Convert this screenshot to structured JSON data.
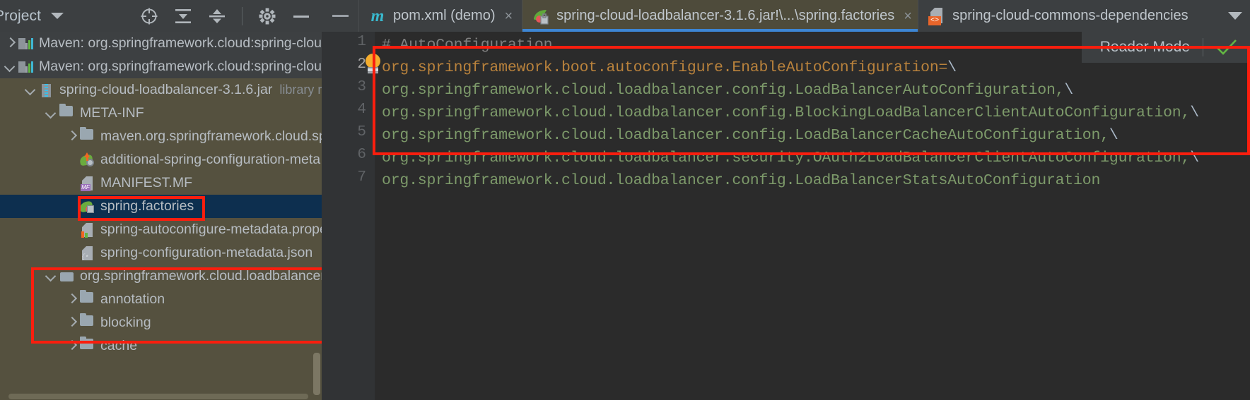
{
  "left_panel": {
    "title": "Project",
    "toolbar_icons": [
      {
        "name": "locate-target-icon"
      },
      {
        "name": "expand-all-icon"
      },
      {
        "name": "collapse-all-icon"
      },
      {
        "name": "settings-gear-icon"
      },
      {
        "name": "hide-panel-icon"
      }
    ],
    "tree": [
      {
        "label": "Maven: org.springframework.cloud:spring-cloud-",
        "arrow": "right",
        "icon": "maven-icon",
        "indent": 0,
        "bg": "dark",
        "suffix": ""
      },
      {
        "label": "Maven: org.springframework.cloud:spring-cloud-",
        "arrow": "down",
        "icon": "maven-icon",
        "indent": 0,
        "bg": "dark",
        "suffix": ""
      },
      {
        "label": "spring-cloud-loadbalancer-3.1.6.jar",
        "arrow": "down",
        "icon": "jar-icon",
        "indent": 1,
        "bg": "",
        "suffix": "library ro"
      },
      {
        "label": "META-INF",
        "arrow": "down",
        "icon": "folder-icon",
        "indent": 2,
        "bg": "",
        "suffix": ""
      },
      {
        "label": "maven.org.springframework.cloud.spr",
        "arrow": "right",
        "icon": "folder-icon",
        "indent": 3,
        "bg": "",
        "suffix": ""
      },
      {
        "label": "additional-spring-configuration-meta",
        "arrow": "none",
        "icon": "spring-config-metadata-icon",
        "indent": 3,
        "bg": "",
        "suffix": ""
      },
      {
        "label": "MANIFEST.MF",
        "arrow": "none",
        "icon": "manifest-icon",
        "indent": 3,
        "bg": "",
        "suffix": ""
      },
      {
        "label": "spring.factories",
        "arrow": "none",
        "icon": "spring-factories-icon",
        "indent": 3,
        "bg": "selected",
        "suffix": ""
      },
      {
        "label": "spring-autoconfigure-metadata.prope",
        "arrow": "none",
        "icon": "properties-icon",
        "indent": 3,
        "bg": "",
        "suffix": ""
      },
      {
        "label": "spring-configuration-metadata.json",
        "arrow": "none",
        "icon": "json-icon",
        "indent": 3,
        "bg": "",
        "suffix": ""
      },
      {
        "label": "org.springframework.cloud.loadbalancer",
        "arrow": "down",
        "icon": "package-icon",
        "indent": 2,
        "bg": "",
        "suffix": ""
      },
      {
        "label": "annotation",
        "arrow": "right",
        "icon": "folder-icon",
        "indent": 3,
        "bg": "",
        "suffix": ""
      },
      {
        "label": "blocking",
        "arrow": "right",
        "icon": "folder-icon",
        "indent": 3,
        "bg": "",
        "suffix": ""
      },
      {
        "label": "cache",
        "arrow": "right",
        "icon": "folder-icon",
        "indent": 3,
        "bg": "",
        "suffix": ""
      }
    ]
  },
  "tabs": [
    {
      "label": "pom.xml (demo)",
      "icon": "maven-m-icon",
      "active": false,
      "close": "×"
    },
    {
      "label": "spring-cloud-loadbalancer-3.1.6.jar!\\...\\spring.factories",
      "icon": "spring-factories-icon",
      "active": true,
      "close": "×"
    },
    {
      "label": "spring-cloud-commons-dependencies",
      "icon": "xml-file-icon",
      "active": false,
      "close": ""
    }
  ],
  "editor": {
    "line_numbers": [
      "1",
      "2",
      "3",
      "4",
      "5",
      "6",
      "7"
    ],
    "current_line": "2",
    "lines": [
      {
        "n": 1,
        "segments": [
          {
            "text": "# AutoConfiguration",
            "cls": "c-comment"
          }
        ]
      },
      {
        "n": 2,
        "segments": [
          {
            "text": "org.springframework.boot.autoconfigure.EnableAutoConfiguration=",
            "cls": "c-key"
          },
          {
            "text": "\\",
            "cls": "c-punc"
          }
        ]
      },
      {
        "n": 3,
        "segments": [
          {
            "text": "org.springframework.cloud.loadbalancer.config.LoadBalancerAutoConfiguration,",
            "cls": "c-val"
          },
          {
            "text": "\\",
            "cls": "c-punc"
          }
        ]
      },
      {
        "n": 4,
        "segments": [
          {
            "text": "org.springframework.cloud.loadbalancer.config.BlockingLoadBalancerClientAutoConfiguration,",
            "cls": "c-val"
          },
          {
            "text": "\\",
            "cls": "c-punc"
          }
        ]
      },
      {
        "n": 5,
        "segments": [
          {
            "text": "org.springframework.cloud.loadbalancer.config.LoadBalancerCacheAutoConfiguration,",
            "cls": "c-val"
          },
          {
            "text": "\\",
            "cls": "c-punc"
          }
        ]
      },
      {
        "n": 6,
        "segments": [
          {
            "text": "org.springframework.cloud.loadbalancer.security.OAuth2LoadBalancerClientAutoConfiguration,",
            "cls": "c-val"
          },
          {
            "text": "\\",
            "cls": "c-punc"
          }
        ]
      },
      {
        "n": 7,
        "segments": [
          {
            "text": "org.springframework.cloud.loadbalancer.config.LoadBalancerStatsAutoConfiguration",
            "cls": "c-val"
          }
        ]
      }
    ],
    "intention_bulb": "lightbulb-icon"
  },
  "reader_mode": {
    "label": "Reader Mode",
    "check_icon": "green-checkmark-icon"
  },
  "colors": {
    "highlight_red": "#fa1e0e",
    "tab_active_underline": "#3d86d4",
    "panel_bg": "#55513f",
    "editor_bg": "#2b2b2b",
    "selection_bg": "#0d2f4f"
  }
}
